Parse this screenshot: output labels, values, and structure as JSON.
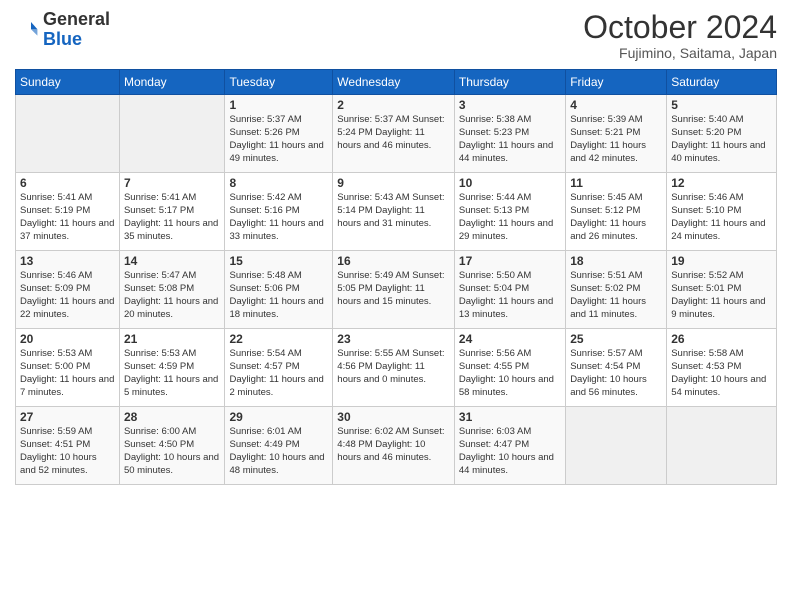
{
  "header": {
    "logo_general": "General",
    "logo_blue": "Blue",
    "month_title": "October 2024",
    "subtitle": "Fujimino, Saitama, Japan"
  },
  "days_of_week": [
    "Sunday",
    "Monday",
    "Tuesday",
    "Wednesday",
    "Thursday",
    "Friday",
    "Saturday"
  ],
  "weeks": [
    [
      {
        "day": "",
        "info": ""
      },
      {
        "day": "",
        "info": ""
      },
      {
        "day": "1",
        "info": "Sunrise: 5:37 AM\nSunset: 5:26 PM\nDaylight: 11 hours and 49 minutes."
      },
      {
        "day": "2",
        "info": "Sunrise: 5:37 AM\nSunset: 5:24 PM\nDaylight: 11 hours and 46 minutes."
      },
      {
        "day": "3",
        "info": "Sunrise: 5:38 AM\nSunset: 5:23 PM\nDaylight: 11 hours and 44 minutes."
      },
      {
        "day": "4",
        "info": "Sunrise: 5:39 AM\nSunset: 5:21 PM\nDaylight: 11 hours and 42 minutes."
      },
      {
        "day": "5",
        "info": "Sunrise: 5:40 AM\nSunset: 5:20 PM\nDaylight: 11 hours and 40 minutes."
      }
    ],
    [
      {
        "day": "6",
        "info": "Sunrise: 5:41 AM\nSunset: 5:19 PM\nDaylight: 11 hours and 37 minutes."
      },
      {
        "day": "7",
        "info": "Sunrise: 5:41 AM\nSunset: 5:17 PM\nDaylight: 11 hours and 35 minutes."
      },
      {
        "day": "8",
        "info": "Sunrise: 5:42 AM\nSunset: 5:16 PM\nDaylight: 11 hours and 33 minutes."
      },
      {
        "day": "9",
        "info": "Sunrise: 5:43 AM\nSunset: 5:14 PM\nDaylight: 11 hours and 31 minutes."
      },
      {
        "day": "10",
        "info": "Sunrise: 5:44 AM\nSunset: 5:13 PM\nDaylight: 11 hours and 29 minutes."
      },
      {
        "day": "11",
        "info": "Sunrise: 5:45 AM\nSunset: 5:12 PM\nDaylight: 11 hours and 26 minutes."
      },
      {
        "day": "12",
        "info": "Sunrise: 5:46 AM\nSunset: 5:10 PM\nDaylight: 11 hours and 24 minutes."
      }
    ],
    [
      {
        "day": "13",
        "info": "Sunrise: 5:46 AM\nSunset: 5:09 PM\nDaylight: 11 hours and 22 minutes."
      },
      {
        "day": "14",
        "info": "Sunrise: 5:47 AM\nSunset: 5:08 PM\nDaylight: 11 hours and 20 minutes."
      },
      {
        "day": "15",
        "info": "Sunrise: 5:48 AM\nSunset: 5:06 PM\nDaylight: 11 hours and 18 minutes."
      },
      {
        "day": "16",
        "info": "Sunrise: 5:49 AM\nSunset: 5:05 PM\nDaylight: 11 hours and 15 minutes."
      },
      {
        "day": "17",
        "info": "Sunrise: 5:50 AM\nSunset: 5:04 PM\nDaylight: 11 hours and 13 minutes."
      },
      {
        "day": "18",
        "info": "Sunrise: 5:51 AM\nSunset: 5:02 PM\nDaylight: 11 hours and 11 minutes."
      },
      {
        "day": "19",
        "info": "Sunrise: 5:52 AM\nSunset: 5:01 PM\nDaylight: 11 hours and 9 minutes."
      }
    ],
    [
      {
        "day": "20",
        "info": "Sunrise: 5:53 AM\nSunset: 5:00 PM\nDaylight: 11 hours and 7 minutes."
      },
      {
        "day": "21",
        "info": "Sunrise: 5:53 AM\nSunset: 4:59 PM\nDaylight: 11 hours and 5 minutes."
      },
      {
        "day": "22",
        "info": "Sunrise: 5:54 AM\nSunset: 4:57 PM\nDaylight: 11 hours and 2 minutes."
      },
      {
        "day": "23",
        "info": "Sunrise: 5:55 AM\nSunset: 4:56 PM\nDaylight: 11 hours and 0 minutes."
      },
      {
        "day": "24",
        "info": "Sunrise: 5:56 AM\nSunset: 4:55 PM\nDaylight: 10 hours and 58 minutes."
      },
      {
        "day": "25",
        "info": "Sunrise: 5:57 AM\nSunset: 4:54 PM\nDaylight: 10 hours and 56 minutes."
      },
      {
        "day": "26",
        "info": "Sunrise: 5:58 AM\nSunset: 4:53 PM\nDaylight: 10 hours and 54 minutes."
      }
    ],
    [
      {
        "day": "27",
        "info": "Sunrise: 5:59 AM\nSunset: 4:51 PM\nDaylight: 10 hours and 52 minutes."
      },
      {
        "day": "28",
        "info": "Sunrise: 6:00 AM\nSunset: 4:50 PM\nDaylight: 10 hours and 50 minutes."
      },
      {
        "day": "29",
        "info": "Sunrise: 6:01 AM\nSunset: 4:49 PM\nDaylight: 10 hours and 48 minutes."
      },
      {
        "day": "30",
        "info": "Sunrise: 6:02 AM\nSunset: 4:48 PM\nDaylight: 10 hours and 46 minutes."
      },
      {
        "day": "31",
        "info": "Sunrise: 6:03 AM\nSunset: 4:47 PM\nDaylight: 10 hours and 44 minutes."
      },
      {
        "day": "",
        "info": ""
      },
      {
        "day": "",
        "info": ""
      }
    ]
  ]
}
